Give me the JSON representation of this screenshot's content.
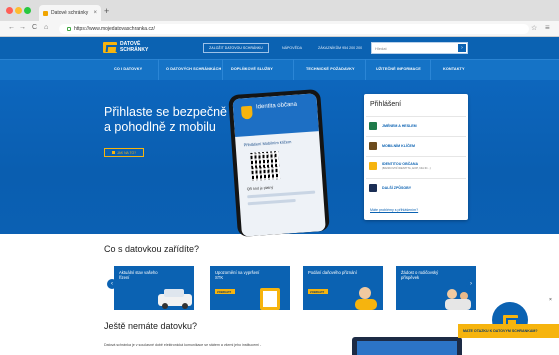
{
  "browser": {
    "tab_title": "Datové schránky",
    "tab_close": "×",
    "new_tab": "+",
    "url": "https://www.mojedatovaschranka.cz/",
    "back": "←",
    "forward": "→",
    "reload": "C",
    "home": "⌂",
    "bookmark": "☆",
    "menu": "≡"
  },
  "header": {
    "logo_text": "DATOVÉ SCHRÁNKY",
    "cta_button": "ZALOŽIT DATOVOU SCHRÁNKU",
    "link_help": "NÁPOVĚDA",
    "link_contact": "ZÁKAZNÍKŮM 954 200 200",
    "search_placeholder": "Hledat",
    "search_button": "›"
  },
  "nav": [
    {
      "label": "CO I DATOVKY"
    },
    {
      "label": "O DATOVÝCH SCHRÁNKÁCH"
    },
    {
      "label": "DOPLŇKOVÉ SLUŽBY"
    },
    {
      "label": "TECHNICKÉ POŽADAVKY"
    },
    {
      "label": "UŽITEČNÉ INFORMACE"
    },
    {
      "label": "KONTAKTY"
    }
  ],
  "hero": {
    "title": "Přihlaste se bezpečně a pohodlně z mobilu",
    "button": "JAK NA TO?",
    "phone_title": "Identita občana",
    "phone_heading": "Přihlášení Mobilním klíčem",
    "phone_note": "QR kód je platný"
  },
  "login": {
    "title": "Přihlášení",
    "options": [
      {
        "label": "JMÉNEM A HESLEM",
        "sub": "",
        "color": "#1f7a4a"
      },
      {
        "label": "MOBILNÍM KLÍČEM",
        "sub": "",
        "color": "#6b4b1d"
      },
      {
        "label": "IDENTITOU OBČANA",
        "sub": "(BANKOVNÍ IDENTITA, EOP, NIA ID...)",
        "color": "#f6b40e"
      },
      {
        "label": "DALŠÍ ZPŮSOBY",
        "sub": "",
        "color": "#1b2e55"
      }
    ],
    "help_link": "Máte problémy s přihlášením?"
  },
  "what": {
    "title": "Co s datovkou zařídíte?",
    "cards": [
      {
        "text": "Aktuální stav vašeho řízení",
        "button": ""
      },
      {
        "text": "Upozornění na vypršení STK",
        "button": "ZOBRAZIT"
      },
      {
        "text": "Podání daňového přiznání",
        "button": "ZOBRAZIT"
      },
      {
        "text": "Žádost o rodičovský příspěvek",
        "button": ""
      }
    ],
    "prev": "‹",
    "next": "›"
  },
  "no_box": {
    "title": "Ještě nemáte datovku?",
    "text": "Datová schránka je v současné době elektronická komunikace se státem a všemi jeho institucemi -"
  },
  "chat": {
    "banner": "MATE OTAZKU K DATOVYM SCHRANKAM?",
    "close": "×"
  },
  "colors": {
    "brand_blue": "#0b62b2",
    "brand_yellow": "#f6b40e"
  }
}
